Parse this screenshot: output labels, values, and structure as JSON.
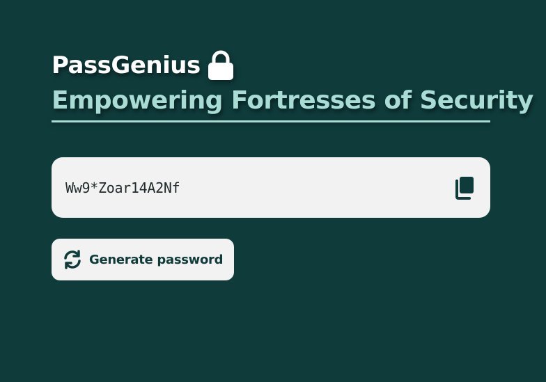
{
  "header": {
    "brand": "PassGenius",
    "brand_icon": "lock-icon",
    "subtitle": "Empowering Fortresses of Security"
  },
  "password": {
    "value": "Ww9*Zoar14A2Nf",
    "copy_icon": "copy-icon"
  },
  "actions": {
    "generate_label": "Generate password",
    "generate_icon": "refresh-icon"
  },
  "colors": {
    "background": "#0f3b3b",
    "accent": "#a8dcd5",
    "surface": "#f2f2f2",
    "text_dark": "#0f3b3b"
  }
}
